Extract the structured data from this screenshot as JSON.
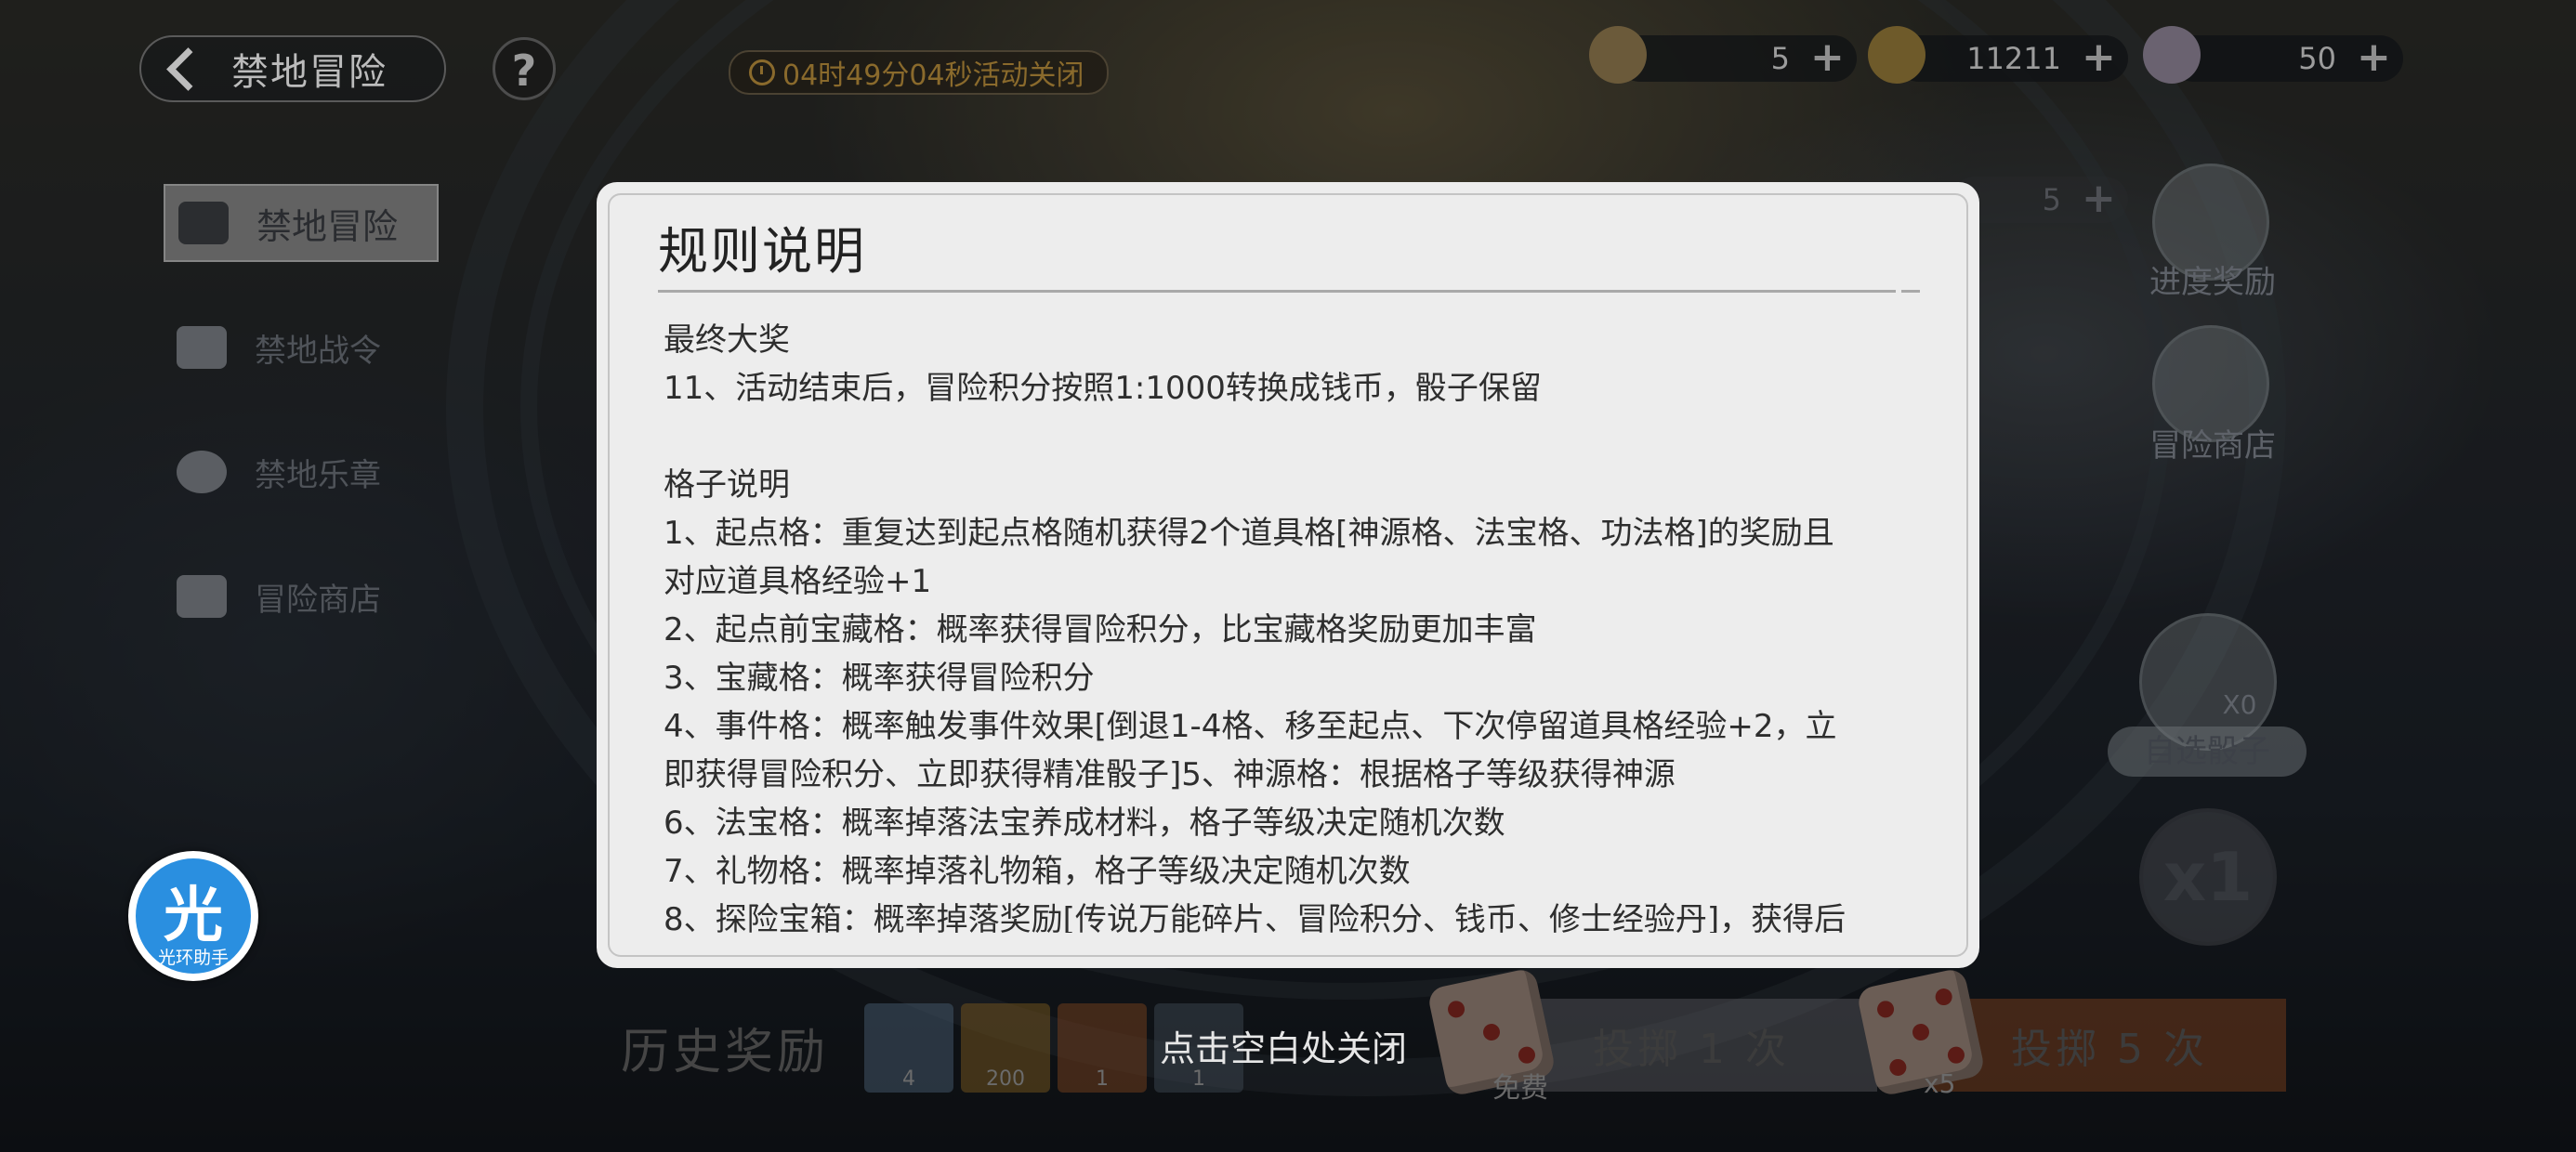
{
  "header": {
    "back_title": "禁地冒险",
    "help_icon": "?",
    "timer_text": "04时49分04秒活动关闭",
    "resources": [
      {
        "icon": "gourd-icon",
        "value": "5"
      },
      {
        "icon": "coin-icon",
        "value": "11211"
      },
      {
        "icon": "crystal-icon",
        "value": "50"
      }
    ],
    "board_count": "5"
  },
  "sidebar": {
    "items": [
      {
        "label": "禁地冒险",
        "icon": "map-icon"
      },
      {
        "label": "禁地战令",
        "icon": "scroll-icon"
      },
      {
        "label": "禁地乐章",
        "icon": "puzzle-icon"
      },
      {
        "label": "冒险商店",
        "icon": "shop-icon"
      }
    ]
  },
  "right_panel": {
    "progress_reward": "进度奖励",
    "adventure_shop": "冒险商店",
    "select_dice_label": "自选骰子",
    "select_dice_count": "X0",
    "multiplier": "x1"
  },
  "bottom": {
    "history_title": "历史奖励",
    "history_items": [
      {
        "count": "4"
      },
      {
        "count": "200"
      },
      {
        "count": "1"
      },
      {
        "count": "1"
      }
    ],
    "roll_once_label": "投掷 1 次",
    "roll_once_cost": "免费",
    "roll_five_label": "投掷 5 次",
    "roll_five_cost": "x5",
    "close_hint": "点击空白处关闭"
  },
  "modal": {
    "title": "规则说明",
    "lines": [
      "最终大奖",
      "11、活动结束后，冒险积分按照1:1000转换成钱币，骰子保留",
      "",
      "格子说明",
      "1、起点格：重复达到起点格随机获得2个道具格[神源格、法宝格、功法格]的奖励且",
      "对应道具格经验+1",
      "2、起点前宝藏格：概率获得冒险积分，比宝藏格奖励更加丰富",
      "3、宝藏格：概率获得冒险积分",
      "4、事件格：概率触发事件效果[倒退1-4格、移至起点、下次停留道具格经验+2，立",
      "即获得冒险积分、立即获得精准骰子]5、神源格：根据格子等级获得神源",
      "6、法宝格：概率掉落法宝养成材料，格子等级决定随机次数",
      "7、礼物格：概率掉落礼物箱，格子等级决定随机次数",
      "8、探险宝箱：概率掉落奖励[传说万能碎片、冒险积分、钱币、修士经验丹]，获得后"
    ]
  },
  "helper": {
    "char": "光",
    "label": "光环助手"
  }
}
